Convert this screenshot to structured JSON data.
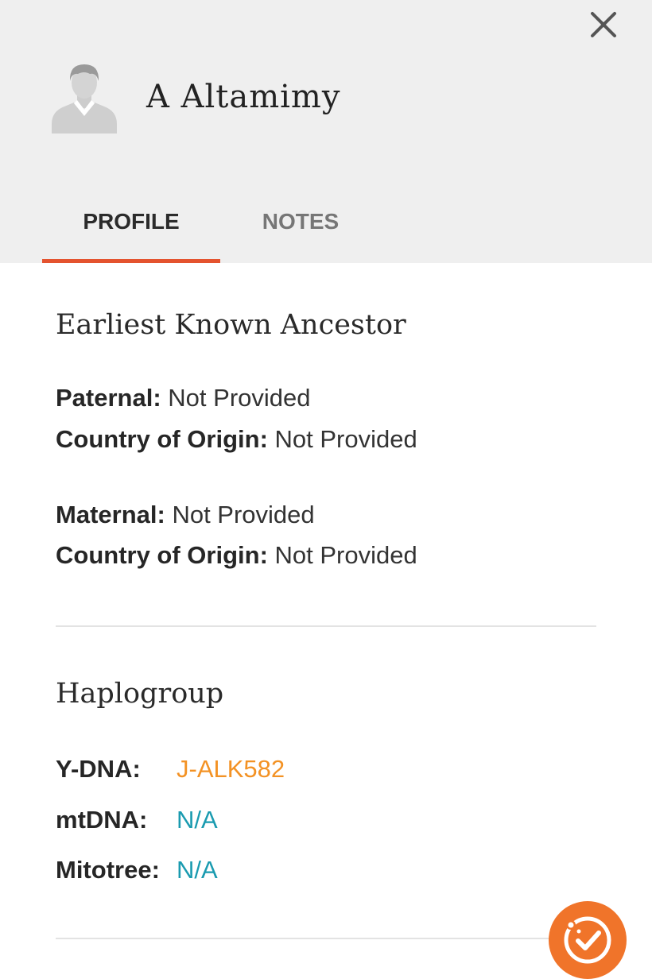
{
  "header": {
    "name": "A Altamimy"
  },
  "tabs": [
    {
      "label": "PROFILE",
      "active": true
    },
    {
      "label": "NOTES",
      "active": false
    }
  ],
  "ancestor": {
    "title": "Earliest Known Ancestor",
    "paternal_label": "Paternal:",
    "paternal_value": "Not Provided",
    "paternal_country_label": "Country of Origin:",
    "paternal_country_value": "Not Provided",
    "maternal_label": "Maternal:",
    "maternal_value": "Not Provided",
    "maternal_country_label": "Country of Origin:",
    "maternal_country_value": "Not Provided"
  },
  "haplogroup": {
    "title": "Haplogroup",
    "ydna_label": "Y-DNA:",
    "ydna_value": "J-ALK582",
    "mtdna_label": "mtDNA:",
    "mtdna_value": "N/A",
    "mitotree_label": "Mitotree:",
    "mitotree_value": "N/A"
  },
  "icons": {
    "close": "close-icon",
    "avatar": "person-silhouette-icon",
    "fab": "dna-check-icon"
  },
  "colors": {
    "header_bg": "#efefef",
    "tab_indicator": "#e4532f",
    "ydna_link": "#f39224",
    "link": "#1a9bb0",
    "fab": "#f0742a"
  }
}
